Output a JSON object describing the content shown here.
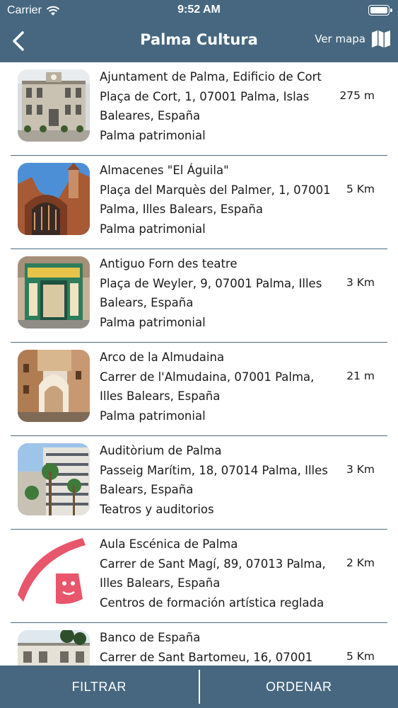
{
  "status": {
    "carrier": "Carrier",
    "time": "9:52 AM"
  },
  "nav": {
    "title": "Palma Cultura",
    "map_label": "Ver mapa"
  },
  "items": [
    {
      "name": "Ajuntament de Palma, Edificio de Cort",
      "address": "Plaça de Cort, 1, 07001 Palma, Islas Baleares, España",
      "category": "Palma patrimonial",
      "distance": "275 m"
    },
    {
      "name": "Almacenes \"El Águila\"",
      "address": "Plaça del Marquès del Palmer, 1, 07001 Palma, Illes Balears, España",
      "category": "Palma patrimonial",
      "distance": "5 Km"
    },
    {
      "name": "Antiguo Forn des teatre",
      "address": "Plaça de Weyler, 9, 07001 Palma, Illes Balears, España",
      "category": "Palma patrimonial",
      "distance": "3 Km"
    },
    {
      "name": "Arco de la Almudaina",
      "address": "Carrer de l'Almudaina, 07001 Palma, Illes Balears, España",
      "category": "Palma patrimonial",
      "distance": "21 m"
    },
    {
      "name": "Auditòrium de Palma",
      "address": "Passeig Marítim, 18, 07014 Palma, Illes Balears, España",
      "category": "Teatros y auditorios",
      "distance": "3 Km"
    },
    {
      "name": "Aula Escénica de Palma",
      "address": "Carrer de Sant Magí, 89, 07013 Palma, Illes Balears, España",
      "category": "Centros de formación artística reglada",
      "distance": "2 Km"
    },
    {
      "name": "Banco de España",
      "address": "Carrer de Sant Bartomeu, 16, 07001",
      "category": "",
      "distance": "5 Km"
    }
  ],
  "tabs": {
    "filter": "FILTRAR",
    "sort": "ORDENAR"
  },
  "colors": {
    "bar": "#46677f",
    "divider": "#4b6a80",
    "accent_logo": "#e8566c"
  },
  "icons": {
    "back": "chevron-left-icon",
    "map": "map-icon",
    "wifi": "wifi-icon",
    "battery": "battery-icon"
  }
}
